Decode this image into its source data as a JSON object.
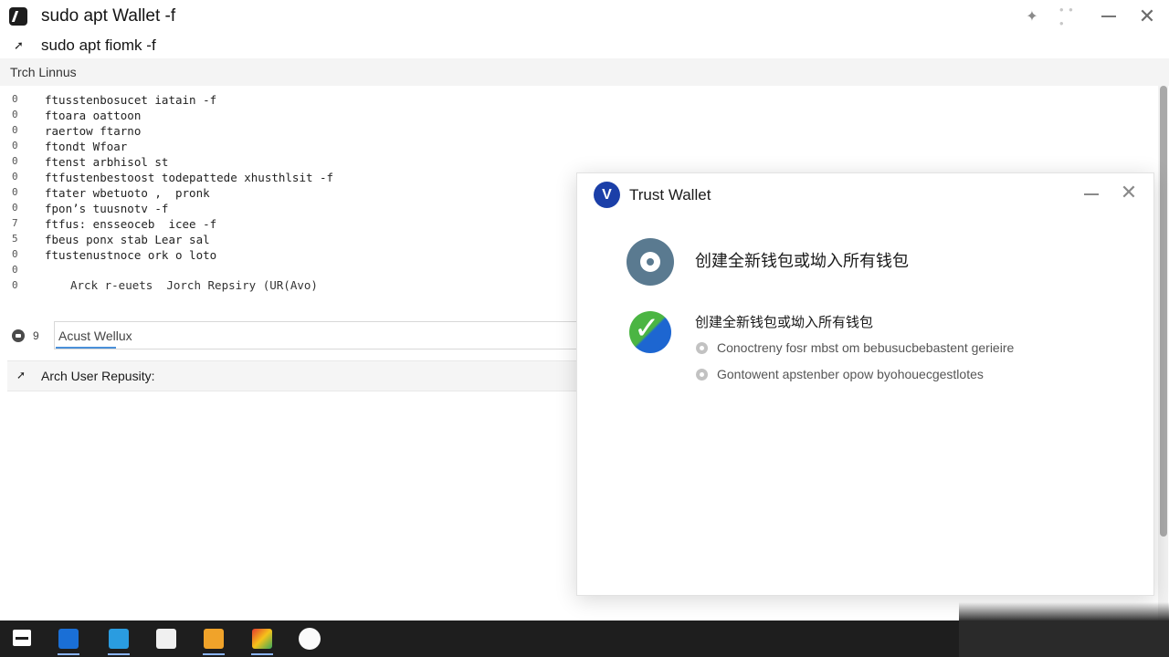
{
  "window": {
    "title": "sudo apt Wallet -f",
    "subtitle": "sudo apt fiomk -f",
    "tab_label": "Trch Linnus",
    "controls": [
      "pin-icon",
      "more-icon",
      "minimize-icon",
      "close-icon"
    ]
  },
  "terminal": {
    "lines": [
      {
        "num": "0",
        "text": "ftusstenbosucet iatain -f"
      },
      {
        "num": "0",
        "text": "ftoara oattoon"
      },
      {
        "num": "0",
        "text": "raertow ftarno"
      },
      {
        "num": "0",
        "text": "ftondt Wfoar"
      },
      {
        "num": "0",
        "text": "ftenst arbhisol st"
      },
      {
        "num": "0",
        "text": "ftfustenbestoost todepattede xhusthlsit -f"
      },
      {
        "num": "0",
        "text": "ftater wbetuoto ,  pronk"
      },
      {
        "num": "0",
        "text": "fpon’s tuusnotv -f"
      },
      {
        "num": "7",
        "text": "ftfus: ensseoceb  icee -f"
      },
      {
        "num": "5",
        "text": "fbeus ponx stab Lear sal"
      },
      {
        "num": "0",
        "text": "ftustenustnoce ork o loto"
      },
      {
        "num": "0",
        "text": ""
      },
      {
        "num": "0",
        "text": ""
      }
    ],
    "search_result_text": "Arck r-euets  Jorch Repsiry (UR(Avo)",
    "input_row_number": "9",
    "search_input_value": "Acust Wellux",
    "aur_label": "Arch User Repusity:"
  },
  "dialog": {
    "title": "Trust Wallet",
    "logo_glyph": "V",
    "option1_label": "创建全新钱包或坳入所有钱包",
    "option2_label": "创建全新钱包或坳入所有钱包",
    "option2_bullets": [
      "Conoctreny fosr mbst om bebusucbebastent gerieire",
      "Gontowent apstenber opow byohouecgestlotes"
    ],
    "colors": {
      "logo_bg": "#1b3fa8",
      "option1_icon": "#5a7a90",
      "option2_green": "#4bb543",
      "option2_blue": "#1d66d1"
    }
  },
  "taskbar": {
    "items": [
      "start-icon",
      "file-explorer-icon",
      "window-app-icon",
      "phone-app-icon",
      "notes-app-icon",
      "photos-app-icon",
      "browser-app-icon"
    ]
  }
}
